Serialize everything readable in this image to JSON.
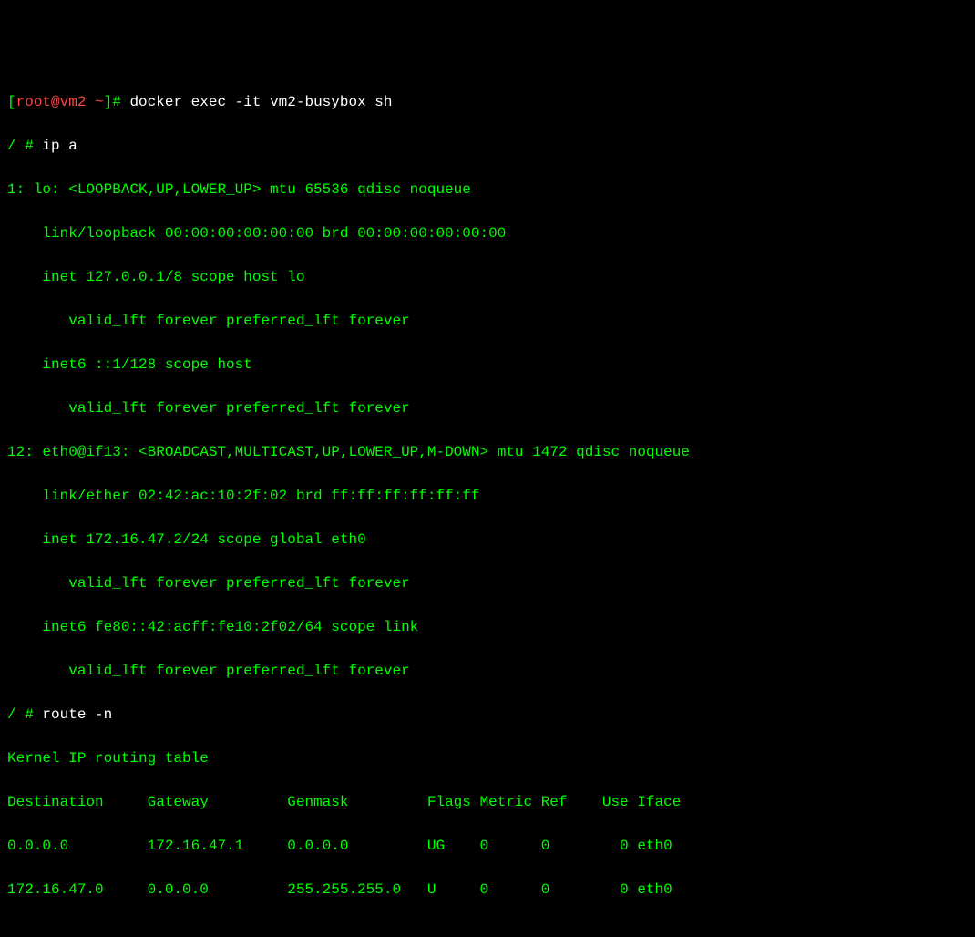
{
  "prompt1": {
    "open_bracket": "[",
    "user_host": "root@vm2 ~",
    "close_bracket": "]#",
    "command": "docker exec -it vm2-busybox sh"
  },
  "prompt2": {
    "ps": "/ #",
    "command": "ip a"
  },
  "ipa": {
    "lo_header": "1: lo: <LOOPBACK,UP,LOWER_UP> mtu 65536 qdisc noqueue ",
    "lo_link": "    link/loopback 00:00:00:00:00:00 brd 00:00:00:00:00:00",
    "lo_inet": "    inet 127.0.0.1/8 scope host lo",
    "lo_inet_valid": "       valid_lft forever preferred_lft forever",
    "lo_inet6": "    inet6 ::1/128 scope host ",
    "lo_inet6_valid": "       valid_lft forever preferred_lft forever",
    "eth_header": "12: eth0@if13: <BROADCAST,MULTICAST,UP,LOWER_UP,M-DOWN> mtu 1472 qdisc noqueue ",
    "eth_link": "    link/ether 02:42:ac:10:2f:02 brd ff:ff:ff:ff:ff:ff",
    "eth_inet": "    inet 172.16.47.2/24 scope global eth0",
    "eth_inet_valid": "       valid_lft forever preferred_lft forever",
    "eth_inet6": "    inet6 fe80::42:acff:fe10:2f02/64 scope link ",
    "eth_inet6_valid": "       valid_lft forever preferred_lft forever"
  },
  "prompt3": {
    "ps": "/ #",
    "command": "route -n"
  },
  "route": {
    "title": "Kernel IP routing table",
    "header": "Destination     Gateway         Genmask         Flags Metric Ref    Use Iface",
    "row1": "0.0.0.0         172.16.47.1     0.0.0.0         UG    0      0        0 eth0",
    "row2": "172.16.47.0     0.0.0.0         255.255.255.0   U     0      0        0 eth0"
  }
}
